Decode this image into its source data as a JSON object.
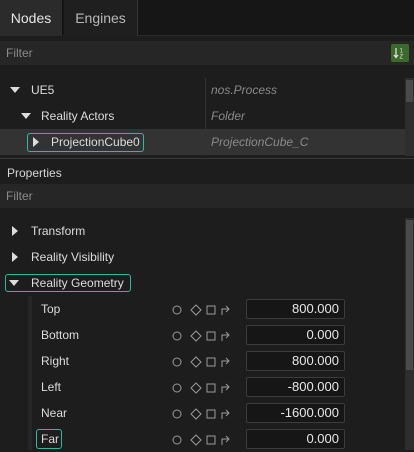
{
  "tabs": [
    {
      "label": "Nodes",
      "active": true
    },
    {
      "label": "Engines",
      "active": false
    }
  ],
  "nodes_filter": {
    "placeholder": "Filter"
  },
  "tree": [
    {
      "label": "UE5",
      "type": "nos.Process",
      "expanded": true
    },
    {
      "label": "Reality Actors",
      "type": "Folder",
      "expanded": true
    },
    {
      "label": "ProjectionCube0",
      "type": "ProjectionCube_C",
      "expanded": false,
      "selected": true
    }
  ],
  "properties": {
    "title": "Properties",
    "filter_placeholder": "Filter",
    "groups": [
      {
        "label": "Transform",
        "expanded": false
      },
      {
        "label": "Reality Visibility",
        "expanded": false
      },
      {
        "label": "Reality Geometry",
        "expanded": true
      }
    ],
    "fields": [
      {
        "label": "Top",
        "value": "800.000"
      },
      {
        "label": "Bottom",
        "value": "0.000"
      },
      {
        "label": "Right",
        "value": "800.000"
      },
      {
        "label": "Left",
        "value": "-800.000"
      },
      {
        "label": "Near",
        "value": "-1600.000"
      },
      {
        "label": "Far",
        "value": "0.000"
      }
    ]
  },
  "colors": {
    "accent": "#2fb8a2",
    "sort_button": "#3b6a2a",
    "background": "#1d1d1d"
  },
  "icons": [
    "sort-icon",
    "caret-down-icon",
    "caret-right-icon",
    "reset-circle-icon",
    "keyframe-diamond-icon",
    "checkbox-square-icon",
    "link-arrow-icon"
  ]
}
